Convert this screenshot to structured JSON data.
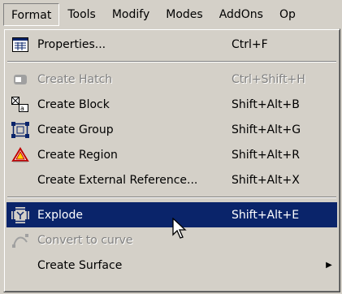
{
  "menubar": {
    "items": [
      {
        "label": "Format"
      },
      {
        "label": "Tools"
      },
      {
        "label": "Modify"
      },
      {
        "label": "Modes"
      },
      {
        "label": "AddOns"
      },
      {
        "label": "Op"
      }
    ]
  },
  "menu": {
    "items": [
      {
        "label": "Properties...",
        "shortcut": "Ctrl+F",
        "icon": "properties-icon"
      },
      {
        "label": "Create Hatch",
        "shortcut": "Ctrl+Shift+H",
        "icon": "hatch-icon"
      },
      {
        "label": "Create Block",
        "shortcut": "Shift+Alt+B",
        "icon": "block-icon"
      },
      {
        "label": "Create Group",
        "shortcut": "Shift+Alt+G",
        "icon": "group-icon"
      },
      {
        "label": "Create Region",
        "shortcut": "Shift+Alt+R",
        "icon": "region-icon"
      },
      {
        "label": "Create External Reference...",
        "shortcut": "Shift+Alt+X"
      },
      {
        "label": "Explode",
        "shortcut": "Shift+Alt+E",
        "icon": "explode-icon"
      },
      {
        "label": "Convert to curve",
        "icon": "curve-icon"
      },
      {
        "label": "Create Surface",
        "icon": "submenu-arrow-icon"
      }
    ]
  },
  "colors": {
    "menu_bg": "#d4d0c8",
    "highlight": "#0a246a",
    "disabled_text": "#808080"
  }
}
